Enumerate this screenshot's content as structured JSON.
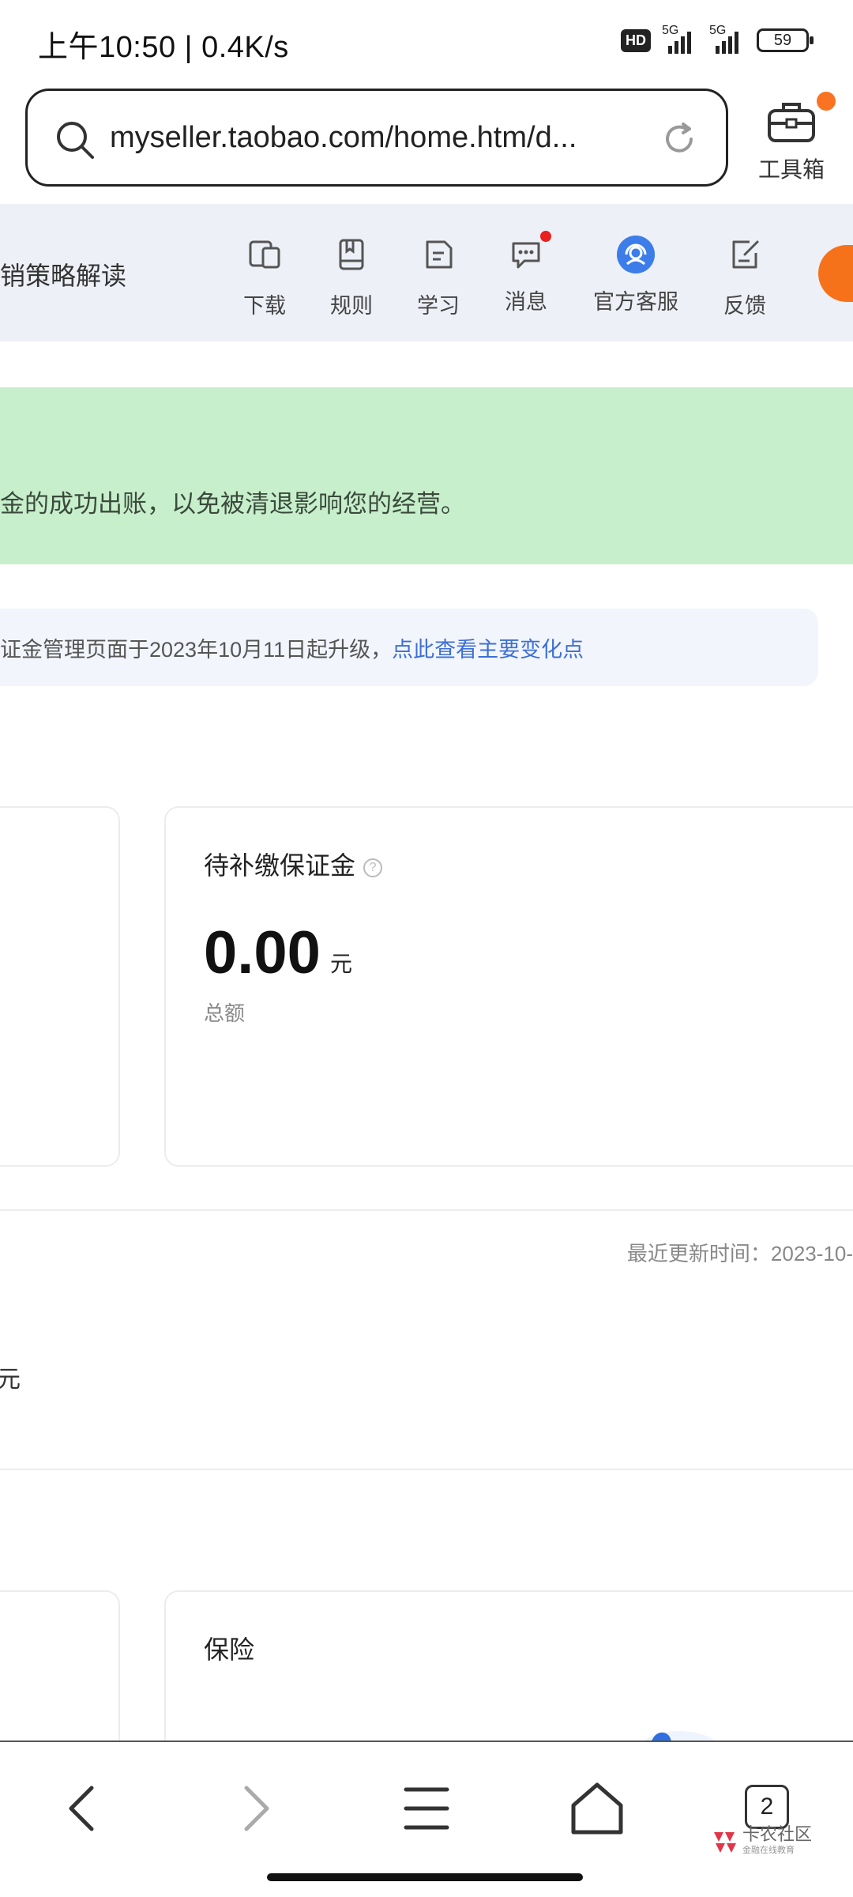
{
  "status_bar": {
    "time_speed": "上午10:50 | 0.4K/s",
    "hd": "HD",
    "sim1_net": "5G",
    "sim2_net": "5G",
    "battery": "59"
  },
  "url_bar": {
    "url": "myseller.taobao.com/home.htm/d..."
  },
  "toolbox": {
    "label": "工具箱"
  },
  "nav_strip": {
    "title": "销策略解读",
    "items": [
      {
        "label": "下载"
      },
      {
        "label": "规则"
      },
      {
        "label": "学习"
      },
      {
        "label": "消息"
      },
      {
        "label": "官方客服"
      },
      {
        "label": "反馈"
      }
    ]
  },
  "notice": {
    "text": "金的成功出账，以免被清退影响您的经营。"
  },
  "info_bar": {
    "text": "证金管理页面于2023年10月11日起升级，",
    "link": "点此查看主要变化点"
  },
  "pending_card": {
    "title": "待补缴保证金",
    "amount": "0.00",
    "unit": "元",
    "sub": "总额"
  },
  "update_time": "最近更新时间：2023-10-",
  "edge_unit": "元",
  "insurance_card": {
    "title": "保险"
  },
  "bottom_nav": {
    "tab_count": "2"
  },
  "watermark": {
    "name": "卡农社区",
    "sub": "金融在线教育"
  },
  "colors": {
    "notice_bg": "#c8efcc",
    "link": "#3c6fd6",
    "accent_orange": "#f97322",
    "cs_blue": "#3d7dea",
    "nav_bg": "#eef0f7"
  }
}
